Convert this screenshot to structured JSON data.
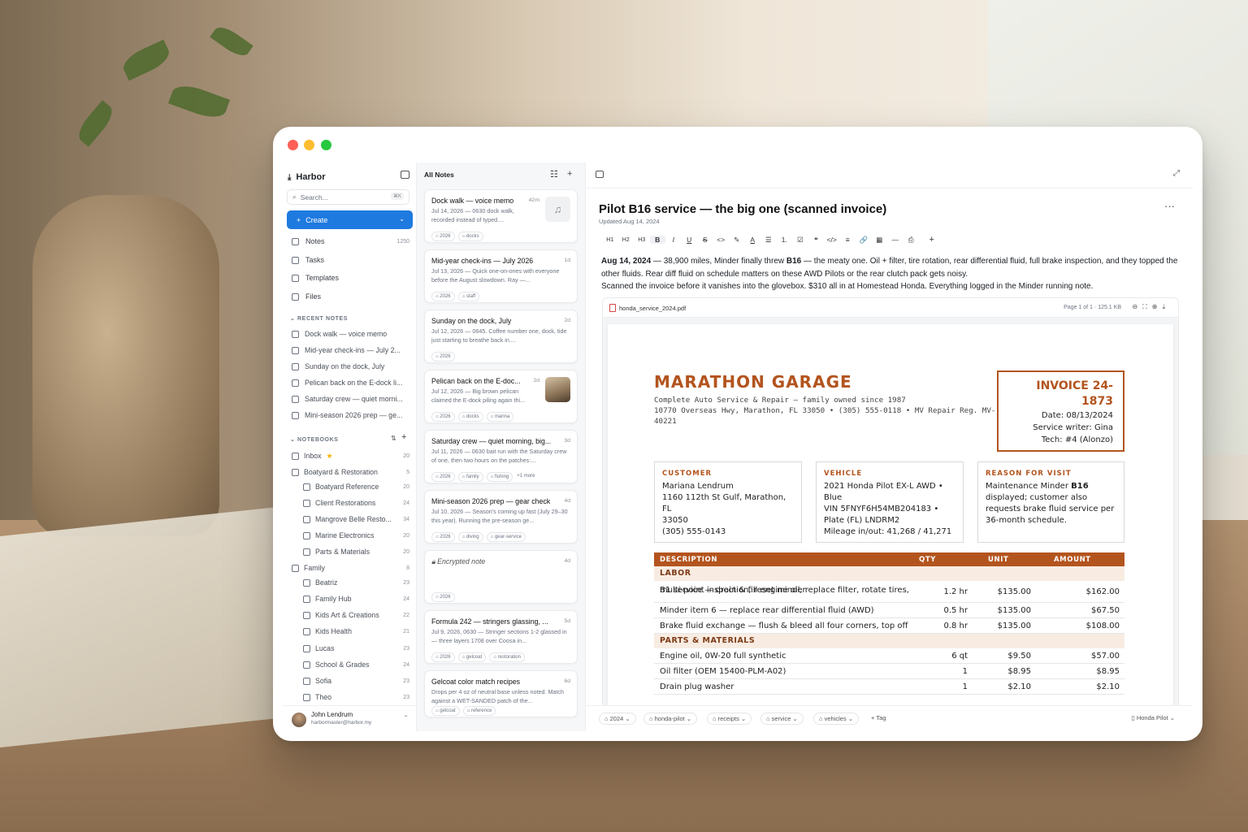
{
  "app": {
    "name": "Harbor"
  },
  "sidebar": {
    "search_placeholder": "Search...",
    "search_shortcut": "⌘K",
    "create_label": "Create",
    "nav": [
      {
        "label": "Notes",
        "count": "1250",
        "icon": "notes-icon"
      },
      {
        "label": "Tasks",
        "count": "",
        "icon": "tasks-icon"
      },
      {
        "label": "Templates",
        "count": "",
        "icon": "templates-icon"
      },
      {
        "label": "Files",
        "count": "",
        "icon": "files-icon"
      }
    ],
    "recent_heading": "RECENT NOTES",
    "recent": [
      "Dock walk — voice memo",
      "Mid-year check-ins — July 2...",
      "Sunday on the dock, July",
      "Pelican back on the E-dock li...",
      "Saturday crew — quiet morni...",
      "Mini-season 2026 prep — ge..."
    ],
    "notebooks_heading": "NOTEBOOKS",
    "notebooks": [
      {
        "label": "Inbox",
        "count": "20",
        "level": 0,
        "star": true
      },
      {
        "label": "Boatyard & Restoration",
        "count": "5",
        "level": 0
      },
      {
        "label": "Boatyard Reference",
        "count": "20",
        "level": 1
      },
      {
        "label": "Client Restorations",
        "count": "24",
        "level": 1
      },
      {
        "label": "Mangrove Belle Resto...",
        "count": "34",
        "level": 1
      },
      {
        "label": "Marine Electronics",
        "count": "20",
        "level": 1
      },
      {
        "label": "Parts & Materials",
        "count": "20",
        "level": 1
      },
      {
        "label": "Family",
        "count": "8",
        "level": 0
      },
      {
        "label": "Beatriz",
        "count": "23",
        "level": 1
      },
      {
        "label": "Family Hub",
        "count": "24",
        "level": 1
      },
      {
        "label": "Kids Art & Creations",
        "count": "22",
        "level": 1
      },
      {
        "label": "Kids Health",
        "count": "21",
        "level": 1
      },
      {
        "label": "Lucas",
        "count": "23",
        "level": 1
      },
      {
        "label": "School & Grades",
        "count": "24",
        "level": 1
      },
      {
        "label": "Sofia",
        "count": "23",
        "level": 1
      },
      {
        "label": "Theo",
        "count": "23",
        "level": 1
      }
    ],
    "user": {
      "name": "John Lendrum",
      "email": "harbormaster@harbor.my"
    }
  },
  "notes_list": {
    "title": "All Notes",
    "cards": [
      {
        "title": "Dock walk — voice memo",
        "ago": "42m",
        "preview": "Jul 14, 2026 — 0630 dock walk, recorded instead of typed....",
        "tags": [
          "2026",
          "docks"
        ],
        "thumb": "music-note-icon"
      },
      {
        "title": "Mid-year check-ins — July 2026",
        "ago": "1d",
        "preview": "Jul 13, 2026 — Quick one-on-ones with everyone before the August slowdown. Ray —...",
        "tags": [
          "2026",
          "staff"
        ]
      },
      {
        "title": "Sunday on the dock, July",
        "ago": "2d",
        "preview": "Jul 12, 2026 — 0645. Coffee number one, dock, tide just starting to breathe back in....",
        "tags": [
          "2026"
        ]
      },
      {
        "title": "Pelican back on the E-doc...",
        "ago": "2d",
        "preview": "Jul 12, 2026 — Big brown pelican claimed the E-dock piling again thi...",
        "tags": [
          "2026",
          "docks",
          "marina"
        ],
        "thumb": "pelican-photo"
      },
      {
        "title": "Saturday crew — quiet morning, big...",
        "ago": "3d",
        "preview": "Jul 11, 2026 — 0630 bait run with the Saturday crew of one, then two hours on the patches:...",
        "tags": [
          "2026",
          "family",
          "fishing",
          "+1 more"
        ]
      },
      {
        "title": "Mini-season 2026 prep — gear check",
        "ago": "4d",
        "preview": "Jul 10, 2026 — Season's coming up fast (July 29–30 this year). Running the pre-season ge...",
        "tags": [
          "2026",
          "diving",
          "gear-service"
        ]
      },
      {
        "title": "Encrypted note",
        "ago": "4d",
        "preview": "",
        "tags": [
          "2026"
        ],
        "locked": true
      },
      {
        "title": "Formula 242 — stringers glassing, ...",
        "ago": "5d",
        "preview": "Jul 9, 2026, 0630 — Stringer sections 1-2 glassed in — three layers 1708 over Coosa in...",
        "tags": [
          "2026",
          "gelcoat",
          "restoration"
        ]
      },
      {
        "title": "Gelcoat color match recipes",
        "ago": "6d",
        "preview": "Drops per 4 oz of neutral base unless noted. Match against a WET-SANDED patch of the...",
        "tags": [
          "gelcoat",
          "reference"
        ]
      }
    ]
  },
  "note": {
    "title": "Pilot B16 service — the big one (scanned invoice)",
    "updated": "Updated Aug 14, 2024",
    "toolbar": [
      "H1",
      "H2",
      "H3",
      "B",
      "I",
      "U",
      "S",
      "<>",
      "✎",
      "A",
      "☰",
      "1.",
      "☑",
      "❝",
      "</>",
      "≡",
      "🔗",
      "▦",
      "—",
      "⎙",
      "+"
    ],
    "body": {
      "date": "Aug 14, 2024",
      "p1_a": " — 38,900 miles, Minder finally threw ",
      "p1_b": "B16",
      "p1_c": " — the meaty one. Oil + filter, tire rotation, rear differential fluid, full brake inspection, and they topped the other fluids. Rear diff fluid on schedule matters on these AWD Pilots or the rear clutch pack gets noisy.",
      "p2": "Scanned the invoice before it vanishes into the glovebox. $310 all in at Homestead Honda. Everything logged in the Minder running note."
    },
    "attachment": {
      "filename": "honda_service_2024.pdf",
      "page": "Page 1 of 1",
      "size": "125.1 KB"
    },
    "invoice": {
      "shop": "MARATHON GARAGE",
      "tagline": "Complete Auto Service & Repair — family owned since 1987",
      "address1": "10770 Overseas Hwy, Marathon, FL 33050 • (305) 555-0118 • MV Repair Reg. MV-",
      "address2": "40221",
      "number_1": "INVOICE 24-",
      "number_2": "1873",
      "date": "Date: 08/13/2024",
      "writer": "Service writer: Gina",
      "tech": "Tech: #4 (Alonzo)",
      "customer_h": "CUSTOMER",
      "customer": [
        "Mariana Lendrum",
        "1160 112th St Gulf, Marathon, FL",
        "33050",
        "(305) 555-0143"
      ],
      "vehicle_h": "VEHICLE",
      "vehicle": [
        "2021 Honda Pilot EX-L AWD •",
        "Blue",
        "VIN 5FNYF6H54MB204183 •",
        "Plate (FL) LNDRM2",
        "Mileage in/out: 41,268 / 41,271"
      ],
      "reason_h": "REASON FOR VISIT",
      "reason_a": "Maintenance Minder ",
      "reason_b": "B16",
      "reason_c": [
        "displayed; customer also",
        "requests brake fluid service per",
        "36-month schedule."
      ],
      "columns": [
        "DESCRIPTION",
        "QTY",
        "UNIT",
        "AMOUNT"
      ],
      "labor_h": "LABOR",
      "labor": [
        {
          "desc": "B1 service — drain & fill engine oil, replace filter, rotate tires,",
          "desc2": "multi-point inspection, reset minder",
          "qty": "1.2 hr",
          "unit": "$135.00",
          "amount": "$162.00"
        },
        {
          "desc": "Minder item 6 — replace rear differential fluid (AWD)",
          "qty": "0.5 hr",
          "unit": "$135.00",
          "amount": "$67.50"
        },
        {
          "desc": "Brake fluid exchange — flush & bleed all four corners, top off",
          "qty": "0.8 hr",
          "unit": "$135.00",
          "amount": "$108.00"
        }
      ],
      "parts_h": "PARTS & MATERIALS",
      "parts": [
        {
          "desc": "Engine oil, 0W-20 full synthetic",
          "qty": "6 qt",
          "unit": "$9.50",
          "amount": "$57.00"
        },
        {
          "desc": "Oil filter (OEM 15400-PLM-A02)",
          "qty": "1",
          "unit": "$8.95",
          "amount": "$8.95"
        },
        {
          "desc": "Drain plug washer",
          "qty": "1",
          "unit": "$2.10",
          "amount": "$2.10"
        }
      ]
    },
    "bottom_tags": [
      "2024",
      "honda-pilot",
      "receipts",
      "service",
      "vehicles"
    ],
    "add_tag": "+ Tag",
    "notebook": "Honda Pilot"
  }
}
